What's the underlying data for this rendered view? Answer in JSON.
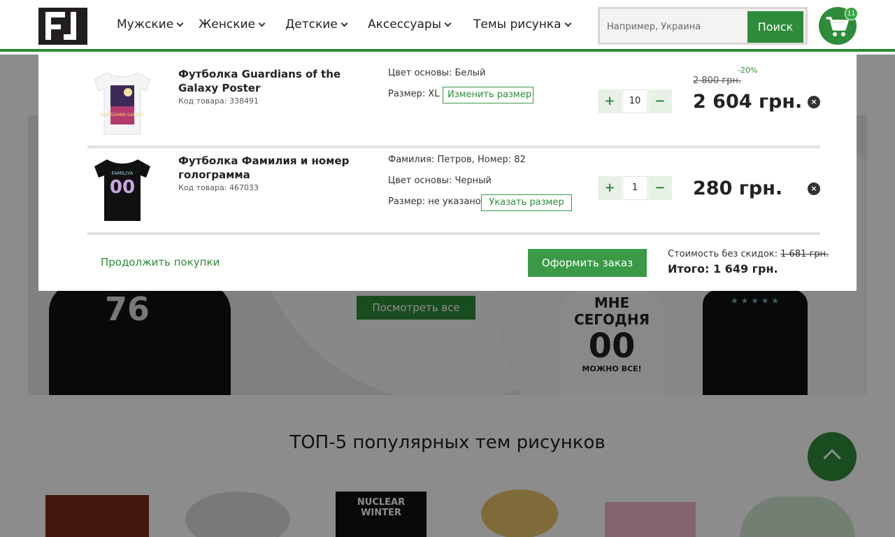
{
  "header": {
    "nav": [
      "Мужские",
      "Женские",
      "Детские",
      "Аксессуары",
      "Темы рисунка"
    ],
    "search_placeholder": "Например, Украина",
    "search_button": "Поиск",
    "cart_count": "11",
    "icons": {
      "cart": "shopping-cart-icon",
      "logo": "brand-logo"
    },
    "colors": {
      "accent": "#2e8b3a",
      "accent_light": "#3a9a46"
    }
  },
  "cart": {
    "items": [
      {
        "name": "Футболка Guardians of the Galaxy Poster",
        "code": "Код товара: 338491",
        "options": [
          "Цвет основы: Белый",
          "Размер: XL"
        ],
        "size_button": "Изменить размер",
        "quantity": "10",
        "old_price": "2 800 грн.",
        "discount": "-20%",
        "price": "2 604 грн."
      },
      {
        "name": "Футболка Фамилия и номер голограмма",
        "code": "Код товара: 467033",
        "options": [
          "Фамилия: Петров, Номер: 82",
          "Цвет основы: Черный",
          "Размер: не указано"
        ],
        "size_button": "Указать размер",
        "quantity": "1",
        "price": "280 грн."
      }
    ],
    "qty_plus": "+",
    "qty_minus": "−",
    "remove_symbol": "×",
    "continue_label": "Продолжить покупки",
    "checkout_label": "Оформить заказ",
    "cost_label": "Стоимость без скидок:",
    "cost_value": "1 681 грн.",
    "total_label": "Итого: 1 649 грн."
  },
  "background_page": {
    "see_all": "Посмотреть все",
    "top5_title": "ТОП-5 популярных тем рисунков",
    "shirt_text_1": "МНЕ СЕГОДНЯ",
    "shirt_text_2": "00",
    "shirt_text_3": "МОЖНО ВСЕ!",
    "thumb_text": "NUCLEAR WINTER",
    "print_1_text": "GUARDIANS GALAXY",
    "print_2_text": "FAMILIYA",
    "print_2_number": "00"
  }
}
